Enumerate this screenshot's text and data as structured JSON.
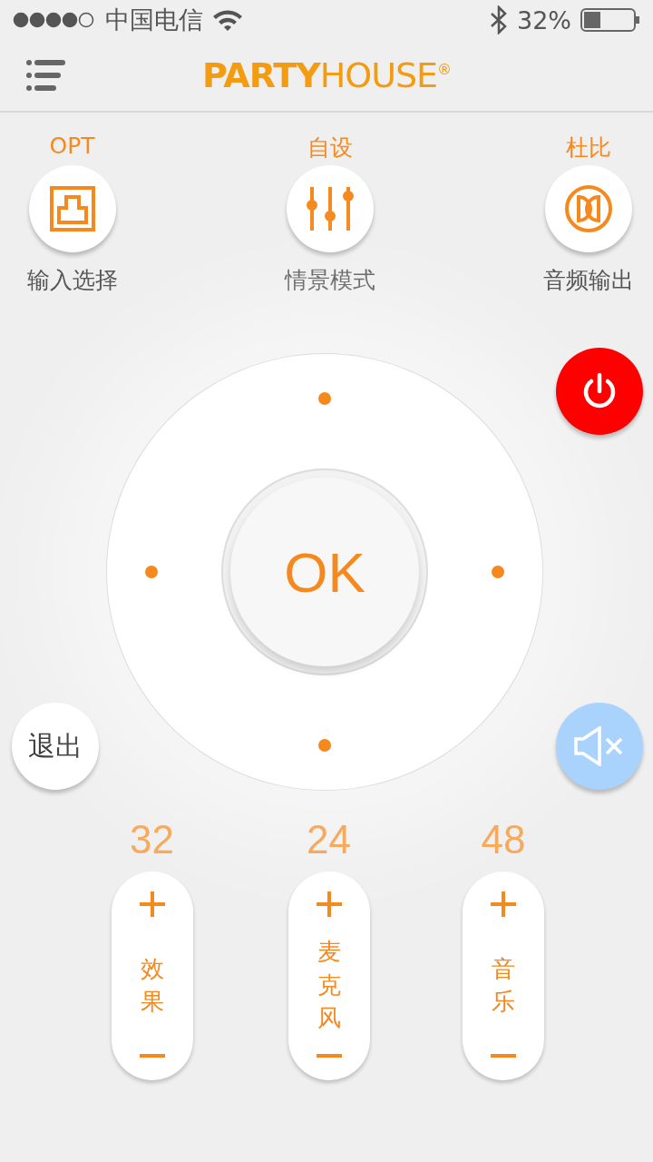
{
  "status_bar": {
    "carrier": "中国电信",
    "battery": "32%"
  },
  "header": {
    "logo": {
      "strong": "PARTY",
      "light": "HOUSE",
      "mark": "®"
    }
  },
  "modes": [
    {
      "value": "OPT",
      "label": "输入选择",
      "kind": "input"
    },
    {
      "value": "自设",
      "label": "情景模式",
      "kind": "scene"
    },
    {
      "value": "杜比",
      "label": "音频输出",
      "kind": "output"
    }
  ],
  "dial": {
    "ok": "OK"
  },
  "exit_button": "退出",
  "volumes": [
    {
      "value": "32",
      "label": "效果"
    },
    {
      "value": "24",
      "label": "麦克风"
    },
    {
      "value": "48",
      "label": "音乐"
    }
  ]
}
